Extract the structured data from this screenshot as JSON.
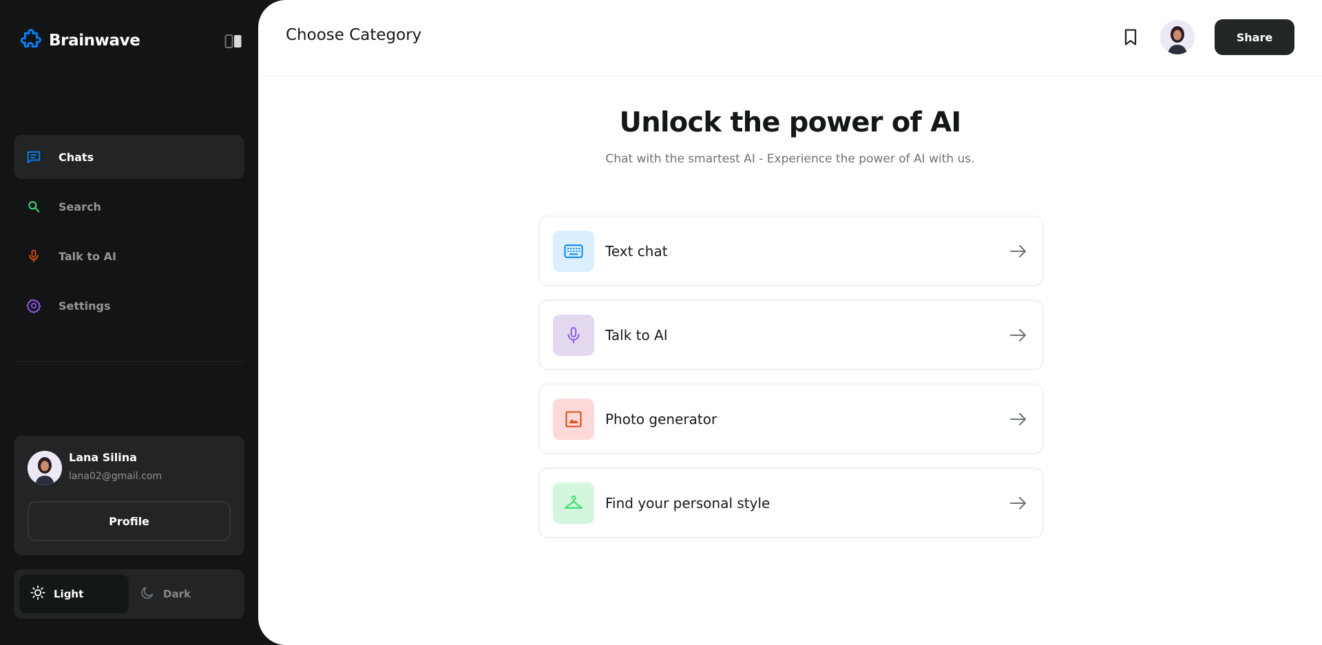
{
  "app": {
    "name": "Brainwave"
  },
  "sidebar": {
    "items": [
      {
        "label": "Chats",
        "icon": "chat-icon",
        "color": "#0084ff",
        "active": true
      },
      {
        "label": "Search",
        "icon": "search-icon",
        "color": "#3fdd78",
        "active": false
      },
      {
        "label": "Talk to AI",
        "icon": "microphone-icon",
        "color": "#d84c10",
        "active": false
      },
      {
        "label": "Settings",
        "icon": "gear-icon",
        "color": "#8e55ea",
        "active": false
      }
    ],
    "user": {
      "name": "Lana Silina",
      "email": "lana02@gmail.com",
      "profile_label": "Profile"
    },
    "theme": {
      "light_label": "Light",
      "dark_label": "Dark",
      "selected": "Light"
    }
  },
  "header": {
    "title": "Choose Category",
    "share_label": "Share"
  },
  "hero": {
    "title": "Unlock the power of AI",
    "subtitle": "Chat with the smartest AI - Experience the power of AI with us."
  },
  "categories": [
    {
      "label": "Text chat",
      "icon": "keyboard-icon",
      "icon_color": "#0084ff",
      "bg_color": "#dcefff"
    },
    {
      "label": "Talk to AI",
      "icon": "microphone-icon",
      "icon_color": "#8e55ea",
      "bg_color": "#e2d9ef"
    },
    {
      "label": "Photo generator",
      "icon": "image-icon",
      "icon_color": "#d84c10",
      "bg_color": "#ffd9d9"
    },
    {
      "label": "Find your personal style",
      "icon": "hanger-icon",
      "icon_color": "#3fdd78",
      "bg_color": "#d4f6dc"
    }
  ]
}
